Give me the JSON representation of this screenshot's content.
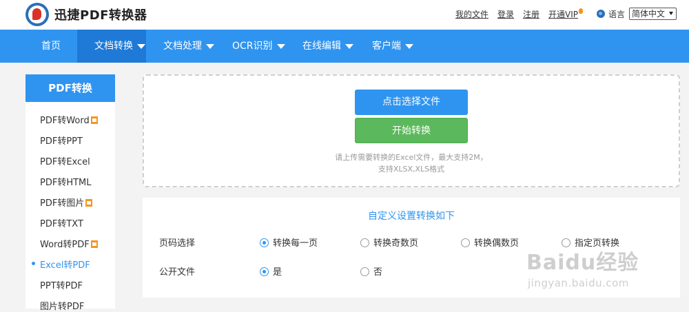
{
  "header": {
    "app_title": "迅捷PDF转换器",
    "links": [
      "我的文件",
      "登录",
      "注册",
      "开通VIP"
    ],
    "language_label": "语言",
    "language_value": "简体中文"
  },
  "nav": {
    "items": [
      "首页",
      "文档转换",
      "文档处理",
      "OCR识别",
      "在线编辑",
      "客户端"
    ],
    "active": "文档转换"
  },
  "sidebar": {
    "title": "PDF转换",
    "items": [
      "PDF转Word",
      "PDF转PPT",
      "PDF转Excel",
      "PDF转HTML",
      "PDF转图片",
      "PDF转TXT",
      "Word转PDF",
      "Excel转PDF",
      "PPT转PDF",
      "图片转PDF"
    ],
    "active": "Excel转PDF"
  },
  "upload": {
    "select_button": "点击选择文件",
    "start_button": "开始转换",
    "hint_line1": "请上传需要转换的Excel文件，最大支持2M，",
    "hint_line2": "支持XLSX,XLS格式"
  },
  "settings": {
    "title": "自定义设置转换如下",
    "page_label": "页码选择",
    "page_options": [
      "转换每一页",
      "转换奇数页",
      "转换偶数页",
      "指定页转换"
    ],
    "page_selected": "转换每一页",
    "public_label": "公开文件",
    "public_options": [
      "是",
      "否"
    ],
    "public_selected": "是"
  },
  "watermark": {
    "main": "Baidu经验",
    "sub": "jingyan.baidu.com"
  },
  "colors": {
    "primary_blue": "#2f94f0",
    "nav_active": "#1e7ad6",
    "start_green": "#5cb85c",
    "badge_orange": "#f7941d"
  }
}
